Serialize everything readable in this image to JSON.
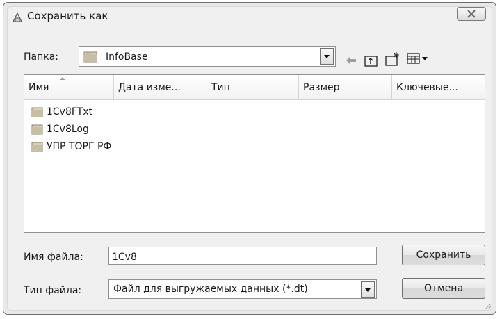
{
  "window": {
    "title": "Сохранить как",
    "close_label": "X"
  },
  "folder_row": {
    "label": "Папка:",
    "value": "InfoBase",
    "icons": [
      "folder-icon",
      "back-arrow-icon",
      "up-folder-icon",
      "new-folder-icon",
      "view-menu-icon"
    ]
  },
  "list": {
    "columns": [
      "Имя",
      "Дата изме...",
      "Тип",
      "Размер",
      "Ключевые..."
    ],
    "sorted_column": "Имя",
    "items": [
      {
        "name": "1Cv8FTxt",
        "icon": "folder-icon"
      },
      {
        "name": "1Cv8Log",
        "icon": "folder-icon"
      },
      {
        "name": "УПР ТОРГ РФ",
        "icon": "folder-icon"
      }
    ]
  },
  "filename": {
    "label": "Имя файла:",
    "value": "1Cv8"
  },
  "filetype": {
    "label": "Тип файла:",
    "value": "Файл для выгружаемых данных (*.dt)"
  },
  "buttons": {
    "save": "Сохранить",
    "cancel": "Отмена"
  }
}
